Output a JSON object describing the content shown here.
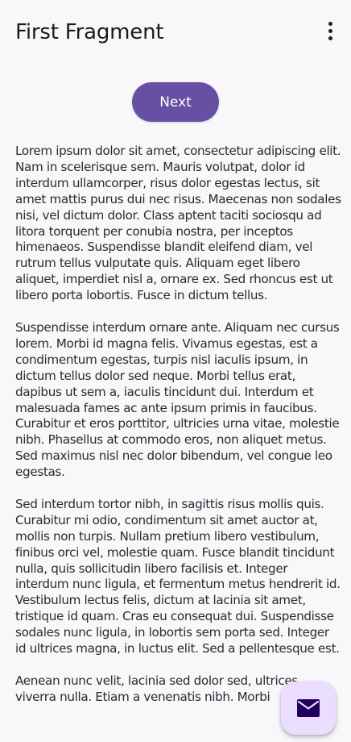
{
  "app_bar": {
    "title": "First Fragment",
    "overflow_icon": "more-vert-icon"
  },
  "main": {
    "next_button_label": "Next",
    "paragraphs": [
      "Lorem ipsum dolor sit amet, consectetur adipiscing elit. Nam in scelerisque sem. Mauris volutpat, dolor id interdum ullamcorper, risus dolor egestas lectus, sit amet mattis purus dui nec risus. Maecenas non sodales nisi, vel dictum dolor. Class aptent taciti sociosqu ad litora torquent per conubia nostra, per inceptos himenaeos. Suspendisse blandit eleifend diam, vel rutrum tellus vulputate quis. Aliquam eget libero aliquet, imperdiet nisl a, ornare ex. Sed rhoncus est ut libero porta lobortis. Fusce in dictum tellus.",
      " Suspendisse interdum ornare ante. Aliquam nec cursus lorem. Morbi id magna felis. Vivamus egestas, est a condimentum egestas, turpis nisl iaculis ipsum, in dictum tellus dolor sed neque. Morbi tellus erat, dapibus ut sem a, iaculis tincidunt dui. Interdum et malesuada fames ac ante ipsum primis in faucibus. Curabitur et eros porttitor, ultricies urna vitae, molestie nibh. Phasellus at commodo eros, non aliquet metus. Sed maximus nisl nec dolor bibendum, vel congue leo egestas.",
      " Sed interdum tortor nibh, in sagittis risus mollis quis. Curabitur mi odio, condimentum sit amet auctor at, mollis non turpis. Nullam pretium libero vestibulum, finibus orci vel, molestie quam. Fusce blandit tincidunt nulla, quis sollicitudin libero facilisis et. Integer interdum nunc ligula, et fermentum metus hendrerit id. Vestibulum lectus felis, dictum at lacinia sit amet, tristique id quam. Cras eu consequat dui. Suspendisse sodales nunc ligula, in lobortis sem porta sed. Integer id ultrices magna, in luctus elit. Sed a pellentesque est.",
      " Aenean nunc velit, lacinia sed dolor sed, ultrices viverra nulla. Etiam a venenatis nibh. Morbi"
    ]
  },
  "fab": {
    "icon": "mail-icon"
  },
  "colors": {
    "primary": "#6750a4",
    "fab_container": "#eaddff",
    "fab_icon": "#21005d",
    "background": "#f8f7fa"
  }
}
